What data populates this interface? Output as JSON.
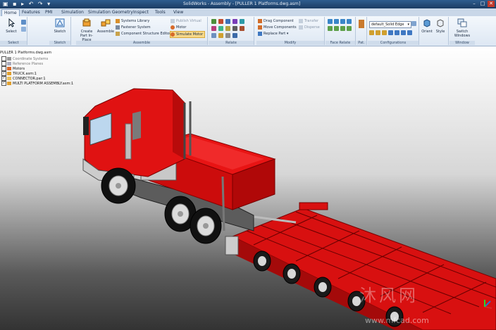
{
  "titlebar": {
    "title": "SolidWorks - Assembly - [PULLER 1 Platforms.dwg.asm]",
    "minimize": "–",
    "maximize": "□",
    "close": "✕"
  },
  "tabs": [
    "Home",
    "Features",
    "PMI",
    "Simulation",
    "Simulation Geometry",
    "Inspect",
    "Tools",
    "View"
  ],
  "ribbon": {
    "select": {
      "label": "Select",
      "group": "Select"
    },
    "sketch": {
      "label": "Sketch",
      "group": "Sketch"
    },
    "assemble": {
      "group": "Assemble",
      "create_part": "Create Part In-Place",
      "assemble": "Assemble",
      "systems_library": "Systems Library",
      "fastener_system": "Fastener System",
      "component_structure_editor": "Component Structure Editor",
      "publish_virtual": "Publish Virtual",
      "motor": "Motor",
      "simulate_motor": "Simulate Motor"
    },
    "relate": {
      "group": "Relate"
    },
    "modify": {
      "group": "Modify",
      "drag_component": "Drag Component",
      "move_components": "Move Components",
      "replace_part": "Replace Part",
      "transfer": "Transfer",
      "disperse": "Disperse"
    },
    "face_relate": {
      "group": "Face Relate"
    },
    "pat": {
      "group": "Pat."
    },
    "configurations": {
      "group": "Configurations",
      "dropdown_value": "default_Solid Edge"
    },
    "orient": {
      "label": "Orient"
    },
    "style": {
      "label": "Style"
    },
    "window": {
      "group": "Window",
      "switch_windows": "Switch Windows"
    }
  },
  "tree": {
    "root": "PULLER 1 Platforms.dwg.asm",
    "items": [
      {
        "label": "Coordinate Systems",
        "checked": false,
        "muted": true
      },
      {
        "label": "Reference Planes",
        "checked": false,
        "muted": true
      },
      {
        "label": "Motors",
        "checked": false,
        "muted": false
      },
      {
        "label": "TRUCK.asm:1",
        "checked": true,
        "muted": false
      },
      {
        "label": "CONNECTOR.par:1",
        "checked": true,
        "muted": false
      },
      {
        "label": "MULTI PLATFORM ASSEMBLY.asm:1",
        "checked": true,
        "muted": false
      }
    ]
  },
  "watermark": {
    "text": "沐风网",
    "url": "www.mfcad.com"
  },
  "colors": {
    "model_red": "#e01212",
    "ribbon_bg": "#e4edf7",
    "highlight": "#f7d98a"
  }
}
